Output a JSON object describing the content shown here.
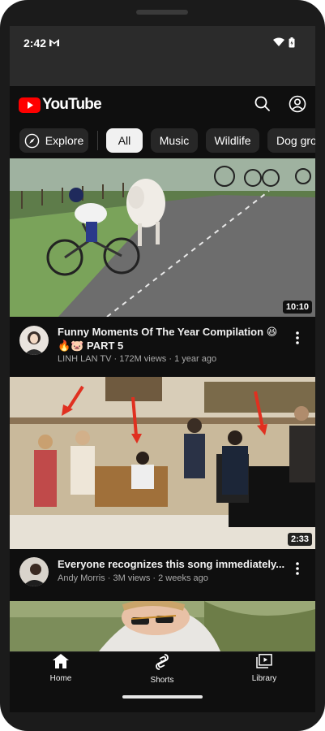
{
  "status_bar": {
    "time": "2:42",
    "icons": [
      "gmail-icon",
      "wifi-icon",
      "battery-icon"
    ]
  },
  "app_bar": {
    "logo_text": "YouTube",
    "icons": [
      "search-icon",
      "account-icon"
    ],
    "brand_color": "#ff0000"
  },
  "chips": [
    {
      "label": "Explore",
      "icon": "compass-icon",
      "selected": false
    },
    {
      "label": "All",
      "selected": true
    },
    {
      "label": "Music",
      "selected": false
    },
    {
      "label": "Wildlife",
      "selected": false
    },
    {
      "label": "Dog groo",
      "selected": false
    }
  ],
  "videos": [
    {
      "title": "Funny Moments Of The Year Compilation 😆🔥🐷 PART 5",
      "channel": "LINH LAN TV",
      "views": "172M views",
      "age": "1 year ago",
      "duration": "10:10",
      "thumbnail": "cyclist-and-cow-on-road"
    },
    {
      "title": "Everyone recognizes this song immediately...",
      "channel": "Andy Morris",
      "views": "3M views",
      "age": "2 weeks ago",
      "duration": "2:33",
      "thumbnail": "pianist-in-public-hall-with-red-arrows"
    },
    {
      "thumbnail": "man-with-sunglasses-outdoors"
    }
  ],
  "bottom_nav": [
    {
      "label": "Home",
      "icon": "home-icon",
      "active": true
    },
    {
      "label": "Shorts",
      "icon": "shorts-icon",
      "active": false
    },
    {
      "label": "Library",
      "icon": "library-icon",
      "active": false
    }
  ]
}
